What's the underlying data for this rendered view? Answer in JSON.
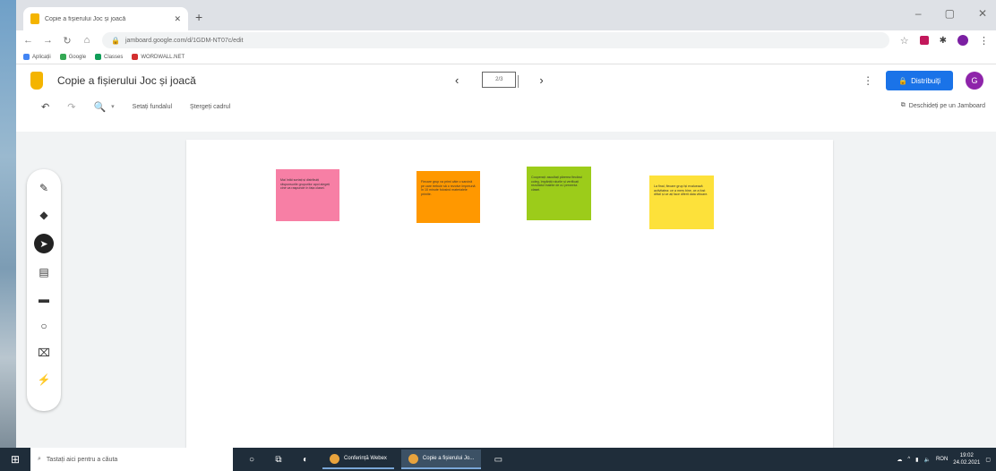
{
  "browser": {
    "tab_title": "Copie a fișierului Joc și joacă",
    "url": "jamboard.google.com/d/1GDM-NT07c/edit",
    "bookmarks": [
      "Aplicații",
      "Google",
      "Classes",
      "WORDWALL.NET"
    ]
  },
  "jamboard": {
    "doc_title": "Copie a fișierului Joc și joacă",
    "frame_label": "2/3",
    "share_label": "Distribuiți",
    "avatar_initial": "G",
    "toolbar": {
      "set_background": "Setați fundalul",
      "clear_frame": "Ștergeți cadrul",
      "open_in_jamboard": "Deschideți pe un Jamboard"
    },
    "notes": [
      {
        "color": "pink",
        "text": "Mai întâi sortați și distribuiți răspunsurile grupurilor apoi alegeți cine va raspunde în fața clasei."
      },
      {
        "color": "orange",
        "text": "Fiecare grup va primi câte o sarcină pe care trebuie să o rezolve împreună în 10 minute folosind materialele primite."
      },
      {
        "color": "green",
        "text": "Cooperați: ascultați părerea fiecărui coleg, împărțiți rolurile și verificați rezultatul înainte de a-l prezenta clasei."
      },
      {
        "color": "yellow",
        "text": "La final, fiecare grup își evaluează activitatea: ce a mers bine, ce a fost dificil și ce ați face diferit data viitoare."
      }
    ]
  },
  "taskbar": {
    "search_placeholder": "Tastați aici pentru a căuta",
    "apps": [
      "Conferință Webex",
      "Copie a fișierului Jo..."
    ],
    "clock_time": "19:02",
    "clock_date": "24.02.2021",
    "lang": "RON"
  }
}
